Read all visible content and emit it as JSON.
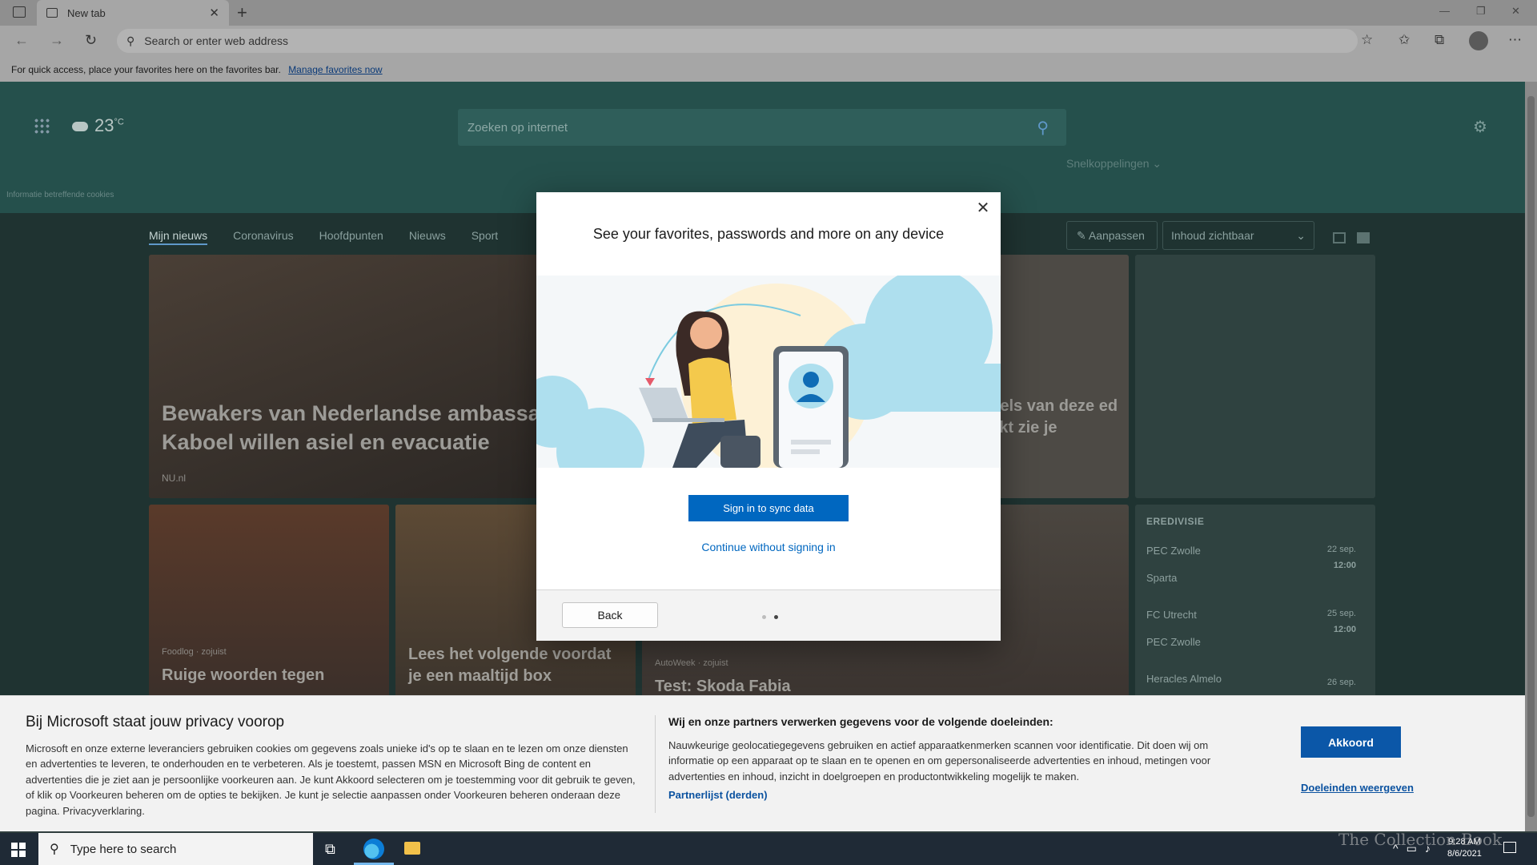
{
  "browser": {
    "tab_title": "New tab",
    "address_placeholder": "Search or enter web address",
    "favorites_bar_text": "For quick access, place your favorites here on the favorites bar.",
    "favorites_bar_link": "Manage favorites now"
  },
  "page": {
    "temperature": "23",
    "temperature_unit": "°C",
    "cookie_info": "Informatie betreffende cookies",
    "search_placeholder": "Zoeken op internet",
    "shortcuts_label": "Snelkoppelingen",
    "news_tabs": [
      "Mijn nieuws",
      "Coronavirus",
      "Hoofdpunten",
      "Nieuws",
      "Sport"
    ],
    "customize_label": "Aanpassen",
    "content_select": "Inhoud zichtbaar",
    "hero": {
      "title": "Bewakers van Nederlandse ambassade Kaboel willen asiel en evacuatie",
      "source": "NU.nl",
      "right_title": "ebels van deze ed kijkt zie je"
    },
    "cards": [
      {
        "source": "Foodlog · zojuist",
        "title": "Ruige woorden tegen"
      },
      {
        "source": "",
        "title": "Lees het volgende voordat je een maaltijd box"
      },
      {
        "source": "AutoWeek · zojuist",
        "title": "Test: Skoda Fabia"
      }
    ],
    "league": {
      "title": "EREDIVISIE",
      "matches": [
        {
          "home": "PEC Zwolle",
          "away": "Sparta",
          "date": "22 sep.",
          "time": "12:00"
        },
        {
          "home": "FC Utrecht",
          "away": "PEC Zwolle",
          "date": "25 sep.",
          "time": "12:00"
        },
        {
          "home": "Heracles Almelo",
          "away": "",
          "date": "26 sep.",
          "time": ""
        }
      ]
    }
  },
  "dialog": {
    "title": "See your favorites, passwords and more on any device",
    "sync_button": "Sign in to sync data",
    "continue_link": "Continue without signing in",
    "back_button": "Back"
  },
  "privacy": {
    "title": "Bij Microsoft staat jouw privacy voorop",
    "body": "Microsoft en onze externe leveranciers gebruiken cookies om gegevens zoals unieke id's op te slaan en te lezen om onze diensten en advertenties te leveren, te onderhouden en te verbeteren. Als je toestemt, passen MSN en Microsoft Bing de content en advertenties die je ziet aan je persoonlijke voorkeuren aan. Je kunt Akkoord selecteren om je toestemming voor dit gebruik te geven, of klik op Voorkeuren beheren om de opties te bekijken. Je kunt je selectie aanpassen onder Voorkeuren beheren onderaan deze pagina. Privacyverklaring.",
    "partners_title": "Wij en onze partners verwerken gegevens voor de volgende doeleinden:",
    "partners_body": "Nauwkeurige geolocatiegegevens gebruiken en actief apparaatkenmerken scannen voor identificatie. Dit doen wij om informatie op een apparaat op te slaan en te openen en om gepersonaliseerde advertenties en inhoud, metingen voor advertenties en inhoud, inzicht in doelgroepen en productontwikkeling mogelijk te maken.",
    "partner_list": "Partnerlijst (derden)",
    "accept_button": "Akkoord",
    "purposes_link": "Doeleinden weergeven"
  },
  "taskbar": {
    "search_placeholder": "Type here to search",
    "time": "9:28 AM",
    "date": "8/6/2021",
    "watermark": "The Collection Book"
  }
}
